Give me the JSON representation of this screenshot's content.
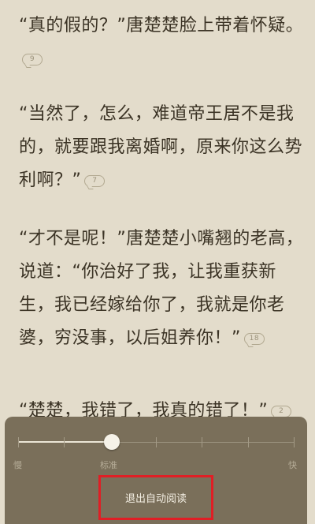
{
  "paragraphs": [
    {
      "text": "“真的假的？”唐楚楚脸上带着怀疑。",
      "comments": "9"
    },
    {
      "text": "“当然了，怎么，难道帝王居不是我的，就要跟我离婚啊，原来你这么势利啊？”",
      "comments": "7"
    },
    {
      "text": "“才不是呢！”唐楚楚小嘴翘的老高，说道：“你治好了我，让我重获新生，我已经嫁给你了，我就是你老婆，穷没事，以后姐养你！”",
      "comments": "18"
    },
    {
      "text": "“楚楚，我错了，我真的错了！”",
      "comments": "2"
    }
  ],
  "auto_read": {
    "speed_slow_label": "慢",
    "speed_standard_label": "标准",
    "speed_fast_label": "快",
    "speed_level": 0.34,
    "exit_label": "退出自动阅读"
  },
  "colors": {
    "page_background": "#e3dccb",
    "text": "#3b3325",
    "panel": "#7a6f5a",
    "highlight_box": "#e01e25"
  }
}
